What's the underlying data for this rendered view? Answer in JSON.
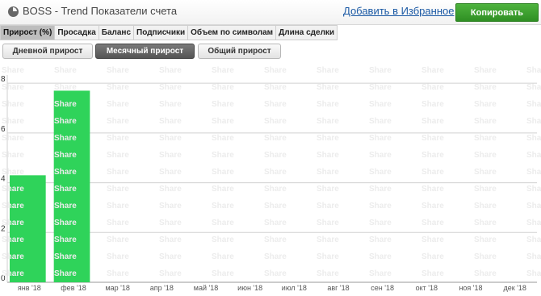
{
  "header": {
    "title": "BOSS - Trend Показатели счета",
    "favorite_link": "Добавить в Избранное",
    "copy_button": "Копировать"
  },
  "tabs": [
    {
      "label": "Прирост (%)",
      "active": true
    },
    {
      "label": "Просадка",
      "active": false
    },
    {
      "label": "Баланс",
      "active": false
    },
    {
      "label": "Подписчики",
      "active": false
    },
    {
      "label": "Объем по символам",
      "active": false
    },
    {
      "label": "Длина сделки",
      "active": false
    }
  ],
  "period_buttons": [
    {
      "label": "Дневной прирост",
      "active": false
    },
    {
      "label": "Месячный прирост",
      "active": true
    },
    {
      "label": "Общий прирост",
      "active": false
    }
  ],
  "watermark": "Share",
  "colors": {
    "bar": "#2fd35a",
    "active_button": "#5c5c5c",
    "copy_button": "#3aa02c",
    "link": "#1c5aa5"
  },
  "chart_data": {
    "type": "bar",
    "categories": [
      "янв '18",
      "фев '18",
      "мар '18",
      "апр '18",
      "май '18",
      "июн '18",
      "июл '18",
      "авг '18",
      "сен '18",
      "окт '18",
      "ноя '18",
      "дек '18"
    ],
    "values": [
      4.3,
      7.7,
      null,
      null,
      null,
      null,
      null,
      null,
      null,
      null,
      null,
      null
    ],
    "yticks": [
      0,
      2,
      4,
      6,
      8
    ],
    "ylim": [
      0,
      8.2
    ],
    "grid": true
  }
}
